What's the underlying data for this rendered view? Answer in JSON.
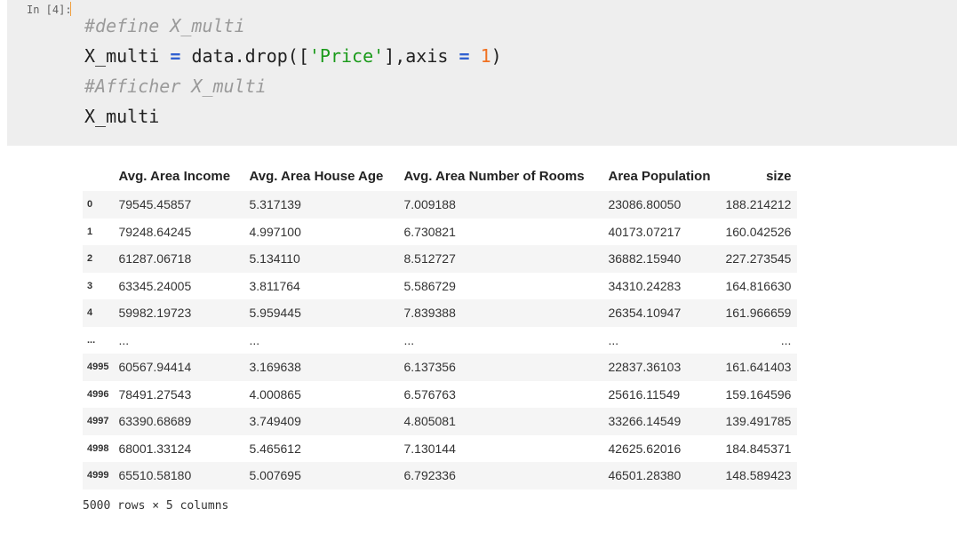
{
  "cell": {
    "prompt": "In [4]:",
    "lines": [
      {
        "comment": "#define X_multi"
      },
      {
        "var": "X_multi",
        "eq": "=",
        "call": "data.drop([",
        "str": "'Price'",
        "mid": "],axis",
        "eq2": "=",
        "num": "1",
        "end": ")"
      },
      {
        "comment": "#Afficher X_multi"
      },
      {
        "plain": "X_multi"
      }
    ]
  },
  "table": {
    "columns": [
      "",
      "Avg. Area Income",
      "Avg. Area House Age",
      "Avg. Area Number of Rooms",
      "Area Population",
      "size"
    ],
    "rows": [
      [
        "0",
        "79545.45857",
        "5.317139",
        "7.009188",
        "23086.80050",
        "188.214212"
      ],
      [
        "1",
        "79248.64245",
        "4.997100",
        "6.730821",
        "40173.07217",
        "160.042526"
      ],
      [
        "2",
        "61287.06718",
        "5.134110",
        "8.512727",
        "36882.15940",
        "227.273545"
      ],
      [
        "3",
        "63345.24005",
        "3.811764",
        "5.586729",
        "34310.24283",
        "164.816630"
      ],
      [
        "4",
        "59982.19723",
        "5.959445",
        "7.839388",
        "26354.10947",
        "161.966659"
      ],
      [
        "...",
        "...",
        "...",
        "...",
        "...",
        "..."
      ],
      [
        "4995",
        "60567.94414",
        "3.169638",
        "6.137356",
        "22837.36103",
        "161.641403"
      ],
      [
        "4996",
        "78491.27543",
        "4.000865",
        "6.576763",
        "25616.11549",
        "159.164596"
      ],
      [
        "4997",
        "63390.68689",
        "3.749409",
        "4.805081",
        "33266.14549",
        "139.491785"
      ],
      [
        "4998",
        "68001.33124",
        "5.465612",
        "7.130144",
        "42625.62016",
        "184.845371"
      ],
      [
        "4999",
        "65510.58180",
        "5.007695",
        "6.792336",
        "46501.28380",
        "148.589423"
      ]
    ]
  },
  "shape_text": "5000 rows × 5 columns"
}
